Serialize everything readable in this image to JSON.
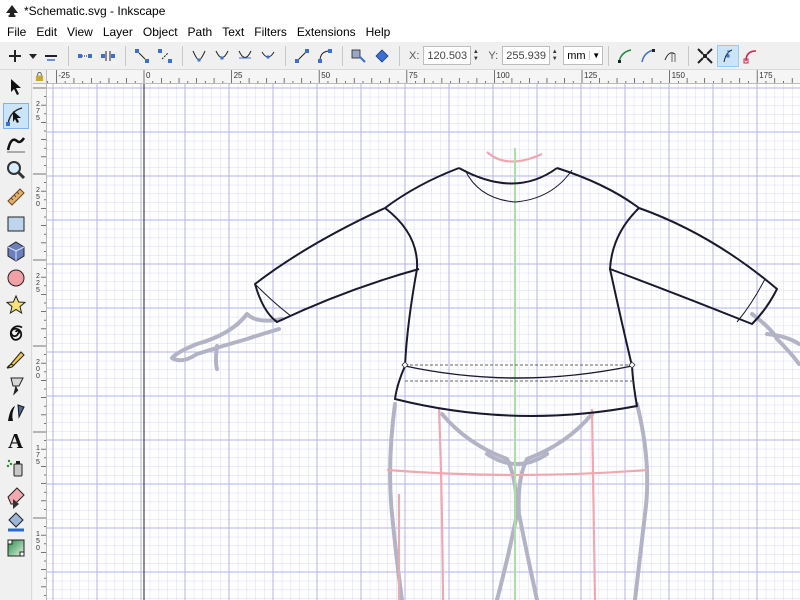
{
  "window": {
    "title": "*Schematic.svg - Inkscape"
  },
  "menu": [
    {
      "label": "File",
      "key": "F",
      "rest": "ile"
    },
    {
      "label": "Edit",
      "key": "E",
      "rest": "dit"
    },
    {
      "label": "View",
      "key": "V",
      "rest": "iew"
    },
    {
      "label": "Layer",
      "key": "L",
      "rest": "ayer"
    },
    {
      "label": "Object",
      "key": "O",
      "rest": "bject"
    },
    {
      "label": "Path",
      "key": "P",
      "rest": "ath"
    },
    {
      "label": "Text",
      "key": "T",
      "rest": "ext"
    },
    {
      "label": "Filters",
      "key": "F",
      "rest": "ilters",
      "underline_index": 5
    },
    {
      "label": "Extensions",
      "key": "x",
      "rest": "tensions",
      "prefix": "E"
    },
    {
      "label": "Help",
      "key": "H",
      "rest": "elp"
    }
  ],
  "toolbar": {
    "x_label": "X:",
    "x_value": "120.503",
    "y_label": "Y:",
    "y_value": "255.939",
    "unit": "mm"
  },
  "ruler": {
    "h_labels": [
      {
        "text": "-25",
        "value": -25
      },
      {
        "text": "0",
        "value": 0
      },
      {
        "text": "25",
        "value": 25
      },
      {
        "text": "50",
        "value": 50
      },
      {
        "text": "75",
        "value": 75
      },
      {
        "text": "100",
        "value": 100
      },
      {
        "text": "125",
        "value": 125
      },
      {
        "text": "150",
        "value": 150
      },
      {
        "text": "175",
        "value": 175
      }
    ],
    "v_labels": [
      {
        "text": "275",
        "value": 275
      },
      {
        "text": "250",
        "value": 250
      },
      {
        "text": "225",
        "value": 225
      },
      {
        "text": "200",
        "value": 200
      },
      {
        "text": "175",
        "value": 175
      },
      {
        "text": "150",
        "value": 150
      }
    ]
  },
  "colors": {
    "grid_minor": "#d6d6f5",
    "grid_major": "#b3b3ee",
    "outline": "#1a1a2e",
    "figure": "#b4b4c4",
    "guide_pink": "#f0a0aa",
    "guide_green": "#a8e0a8",
    "active_tool": "#cce4f7"
  },
  "tools": [
    "selector-arrow-icon",
    "node-edit-icon",
    "tweak-icon",
    "zoom-icon",
    "measure-icon",
    "rectangle-icon",
    "3d-box-icon",
    "ellipse-icon",
    "star-icon",
    "spiral-icon",
    "pencil-icon",
    "pen-icon",
    "calligraphy-icon",
    "text-icon",
    "spray-icon",
    "eraser-icon",
    "paint-bucket-icon",
    "gradient-icon"
  ]
}
